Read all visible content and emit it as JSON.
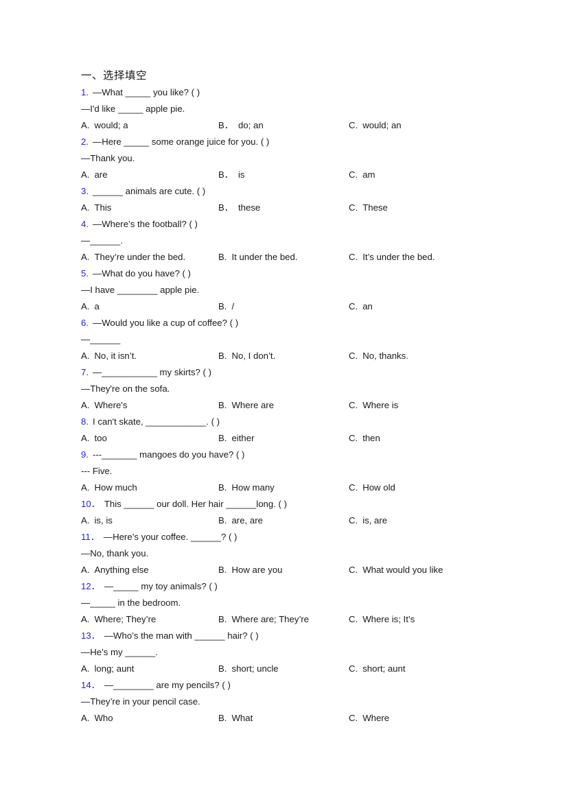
{
  "document": {
    "heading": "一、选择填空",
    "accent_blue": "#2222dd",
    "text_color": "#1a1a1a",
    "background": "#ffffff"
  },
  "questions": [
    {
      "num": "1.",
      "stem": "—What _____ you like? (  )",
      "stem2": "—I'd like _____ apple pie.",
      "a": "A.",
      "a_text": "would; a",
      "b": "B．",
      "b_text": "do; an",
      "c": "C.",
      "c_text": "would; an"
    },
    {
      "num": "2.",
      "stem": "—Here _____ some orange juice for you. (  )",
      "stem2": "—Thank you.",
      "a": "A.",
      "a_text": "are",
      "b": "B．",
      "b_text": "is",
      "c": "C.",
      "c_text": "am"
    },
    {
      "num": "3.",
      "stem": "______ animals are cute. (  )",
      "stem2": "",
      "a": "A.",
      "a_text": "This",
      "b": "B．",
      "b_text": "these",
      "c": "C.",
      "c_text": "These"
    },
    {
      "num": "4.",
      "stem": "—Where’s the football? (  )",
      "stem2": "—______.",
      "a": "A.",
      "a_text": "They’re under the bed.",
      "b": "B.",
      "b_text": "It under the bed.",
      "c": "C.",
      "c_text": "It’s under the bed."
    },
    {
      "num": "5.",
      "stem": "—What do you have? (  )",
      "stem2": "—I have ________ apple pie.",
      "a": "A.",
      "a_text": "a",
      "b": "B.",
      "b_text": "/",
      "c": "C.",
      "c_text": "an"
    },
    {
      "num": "6.",
      "stem": "—Would you like a cup of coffee? (  )",
      "stem2": "—______",
      "a": "A.",
      "a_text": "No, it isn’t.",
      "b": "B.",
      "b_text": "No, I don’t.",
      "c": "C.",
      "c_text": "No, thanks."
    },
    {
      "num": "7.",
      "stem": "—___________ my skirts? (  )",
      "stem2": "—They're on the sofa.",
      "a": "A.",
      "a_text": "Where's",
      "b": "B.",
      "b_text": "Where are",
      "c": "C.",
      "c_text": "Where is"
    },
    {
      "num": "8.",
      "stem": "I can't skate, ____________. (  )",
      "stem2": "",
      "a": "A.",
      "a_text": "too",
      "b": "B.",
      "b_text": "either",
      "c": "C.",
      "c_text": "then"
    },
    {
      "num": "9.",
      "stem": "---_______ mangoes do you have? (  )",
      "stem2": "--- Five.",
      "a": "A.",
      "a_text": "How much",
      "b": "B.",
      "b_text": "How many",
      "c": "C.",
      "c_text": "How old"
    },
    {
      "num": "10．",
      "stem": "This ______ our doll. Her hair ______long. (  )",
      "stem2": "",
      "a": "A.",
      "a_text": "is, is",
      "b": "B.",
      "b_text": "are, are",
      "c": "C.",
      "c_text": "is, are"
    },
    {
      "num": "11．",
      "stem": "—Here’s your coffee. ______? (  )",
      "stem2": "—No, thank you.",
      "a": "A.",
      "a_text": "Anything else",
      "b": "B.",
      "b_text": "How are you",
      "c": "C.",
      "c_text": "What would you like"
    },
    {
      "num": "12．",
      "stem": "—_____ my toy animals? (  )",
      "stem2": "—_____ in the bedroom.",
      "a": "A.",
      "a_text": "Where; They’re",
      "b": "B.",
      "b_text": "Where are; They’re",
      "c": "C.",
      "c_text": "Where is; It’s"
    },
    {
      "num": "13．",
      "stem": "—Who’s the man with ______ hair? (  )",
      "stem2": "—He’s my ______.",
      "a": "A.",
      "a_text": "long; aunt",
      "b": "B.",
      "b_text": "short; uncle",
      "c": "C.",
      "c_text": "short; aunt"
    },
    {
      "num": "14．",
      "stem": "—________ are my pencils? (  )",
      "stem2": "—They’re in your pencil case.",
      "a": "A.",
      "a_text": "Who",
      "b": "B.",
      "b_text": "What",
      "c": "C.",
      "c_text": "Where"
    }
  ]
}
